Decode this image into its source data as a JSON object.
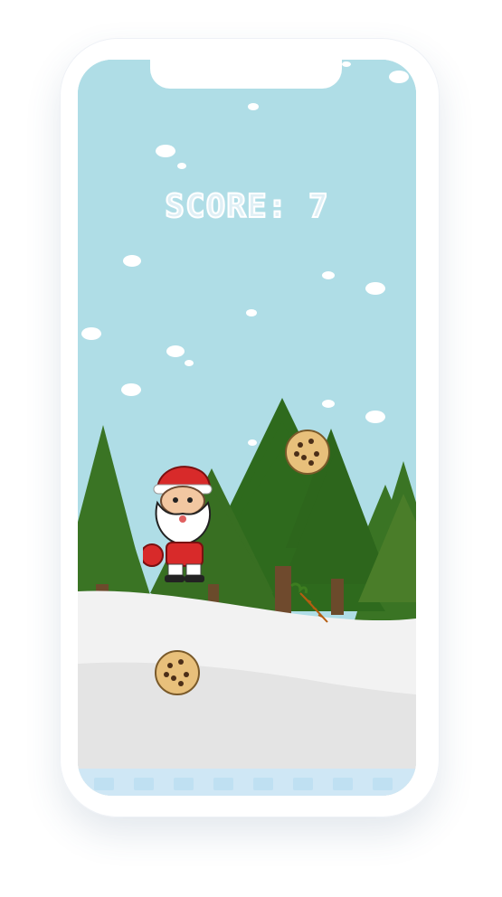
{
  "game": {
    "hud": {
      "score_label": "SCORE:",
      "score_value": "7"
    },
    "colors": {
      "sky": "#afdde6",
      "tree_dark": "#2f6b1f",
      "tree_light": "#4b7b28",
      "snow_front": "#f4f4f4",
      "snow_back": "#e4e4e4",
      "ice": "#cfe7f5"
    },
    "entities": [
      {
        "type": "player",
        "name": "santa"
      },
      {
        "type": "collectible",
        "name": "cookie"
      },
      {
        "type": "collectible",
        "name": "cookie"
      },
      {
        "type": "obstacle",
        "name": "carrot"
      }
    ]
  }
}
